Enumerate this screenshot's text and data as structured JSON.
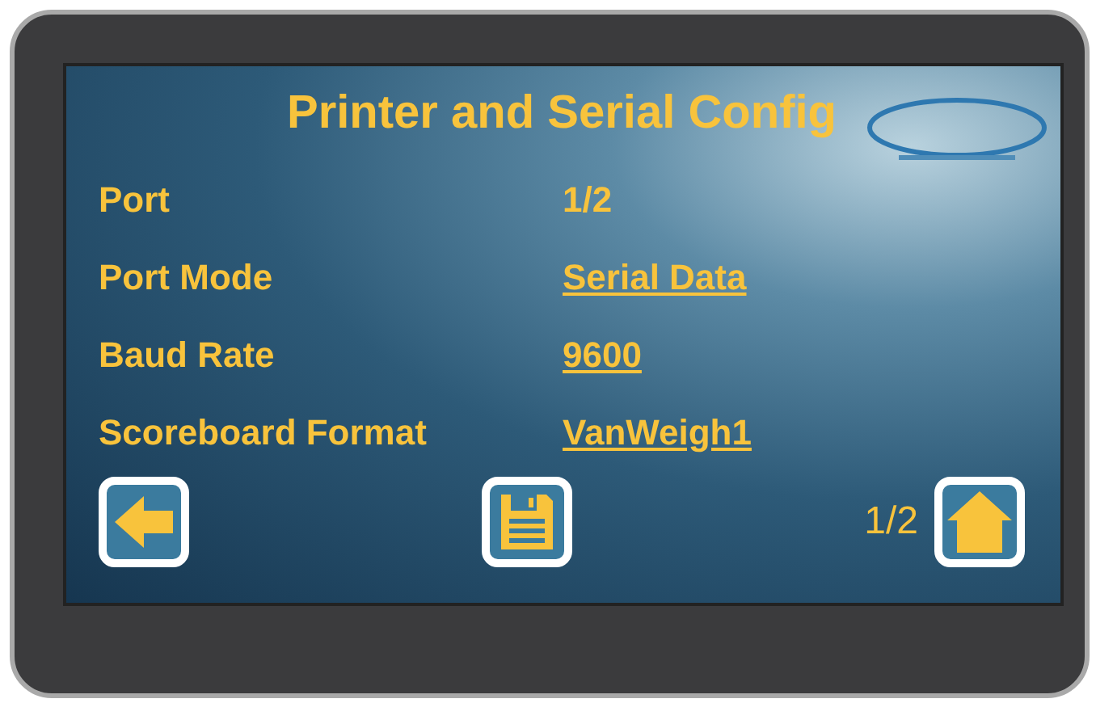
{
  "title": "Printer and Serial Config",
  "settings": [
    {
      "label": "Port",
      "value": "1/2",
      "editable": false
    },
    {
      "label": "Port Mode",
      "value": "Serial Data",
      "editable": true
    },
    {
      "label": "Baud Rate",
      "value": "9600",
      "editable": true
    },
    {
      "label": "Scoreboard Format",
      "value": "VanWeigh1",
      "editable": true
    }
  ],
  "footer": {
    "page": "1/2"
  }
}
